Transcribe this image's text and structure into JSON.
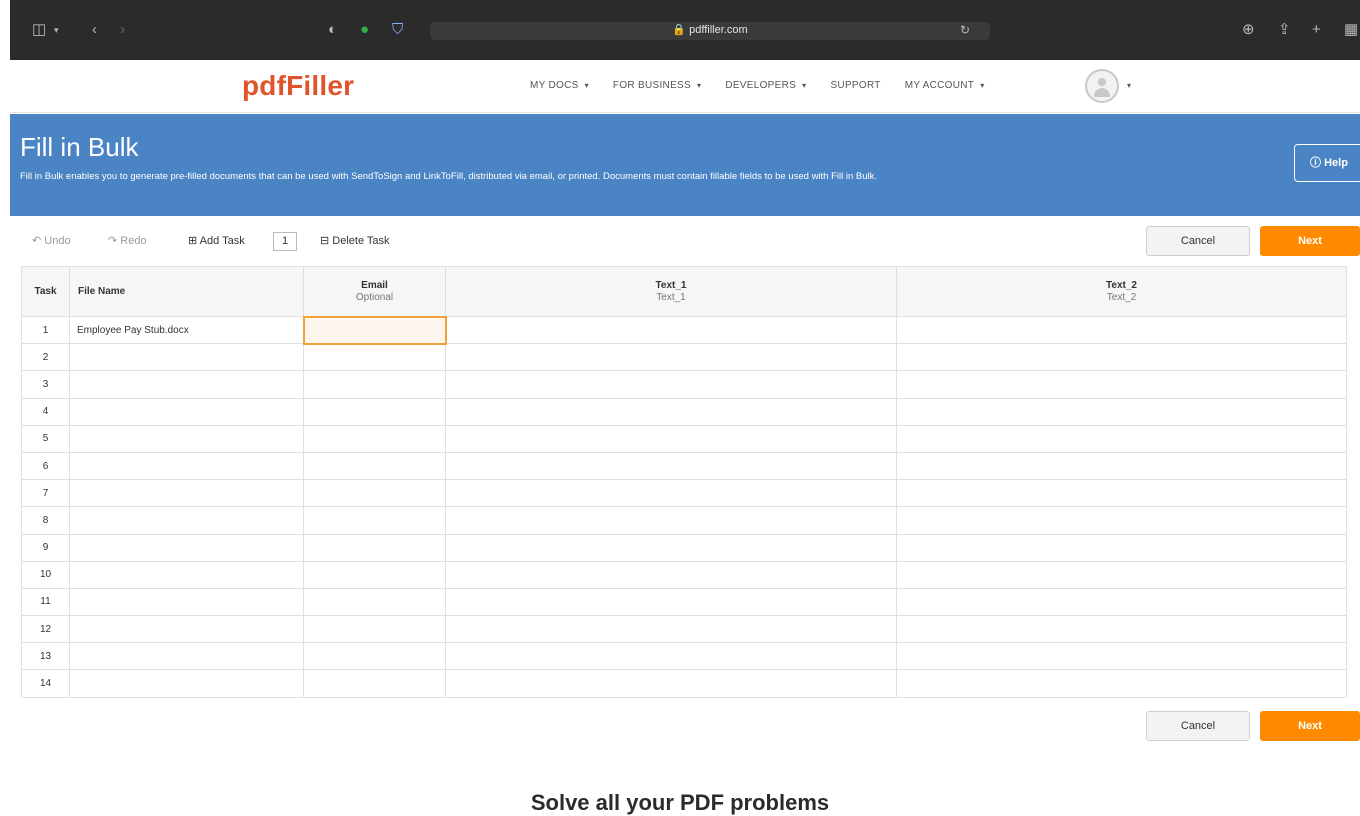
{
  "browser": {
    "url": "pdffiller.com"
  },
  "site": {
    "logo": "pdfFiller",
    "nav": [
      "MY DOCS",
      "FOR BUSINESS",
      "DEVELOPERS",
      "SUPPORT",
      "MY ACCOUNT"
    ]
  },
  "banner": {
    "title": "Fill in Bulk",
    "description": "Fill in Bulk enables you to generate pre-filled documents that can be used with SendToSign and LinkToFill, distributed via email, or printed. Documents must contain fillable fields to be used with Fill in Bulk.",
    "help": "Help"
  },
  "toolbar": {
    "undo": "Undo",
    "redo": "Redo",
    "add_task": "Add Task",
    "task_count": "1",
    "delete_task": "Delete Task",
    "cancel": "Cancel",
    "next": "Next"
  },
  "grid": {
    "headers": {
      "task": "Task",
      "file_name": "File Name",
      "email": "Email",
      "email_sub": "Optional",
      "text1": "Text_1",
      "text1_sub": "Text_1",
      "text2": "Text_2",
      "text2_sub": "Text_2"
    },
    "rows": [
      {
        "num": "1",
        "file": "Employee Pay Stub.docx"
      },
      {
        "num": "2",
        "file": ""
      },
      {
        "num": "3",
        "file": ""
      },
      {
        "num": "4",
        "file": ""
      },
      {
        "num": "5",
        "file": ""
      },
      {
        "num": "6",
        "file": ""
      },
      {
        "num": "7",
        "file": ""
      },
      {
        "num": "8",
        "file": ""
      },
      {
        "num": "9",
        "file": ""
      },
      {
        "num": "10",
        "file": ""
      },
      {
        "num": "11",
        "file": ""
      },
      {
        "num": "12",
        "file": ""
      },
      {
        "num": "13",
        "file": ""
      },
      {
        "num": "14",
        "file": ""
      }
    ]
  },
  "bottom": {
    "cancel": "Cancel",
    "next": "Next",
    "footer_title": "Solve all your PDF problems"
  },
  "colors": {
    "banner": "#4a84c4",
    "logo": "#e0542c",
    "next_button": "#ff8a00"
  }
}
